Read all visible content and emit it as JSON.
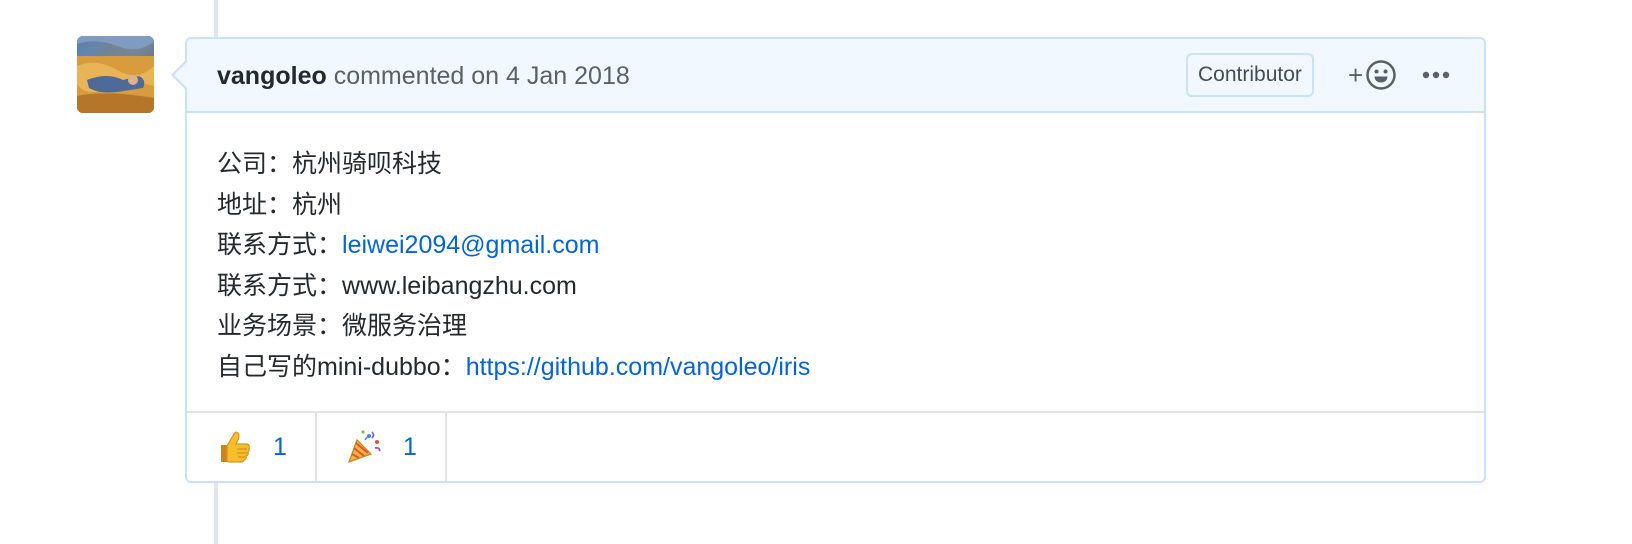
{
  "comment": {
    "author": "vangoleo",
    "action": "commented on",
    "date": "4 Jan 2018",
    "badge": "Contributor",
    "add_reaction_label": "+",
    "icons": {
      "avatar": "user-avatar",
      "add_reaction": "smiley-icon",
      "more": "kebab-horizontal-icon"
    },
    "body": [
      {
        "label": "公司：",
        "value": "杭州骑呗科技",
        "link": false
      },
      {
        "label": "地址：",
        "value": "杭州",
        "link": false
      },
      {
        "label": "联系方式：",
        "value": "leiwei2094@gmail.com",
        "link": true
      },
      {
        "label": "联系方式：",
        "value": "www.leibangzhu.com",
        "link": false
      },
      {
        "label": "业务场景：",
        "value": "微服务治理",
        "link": false
      },
      {
        "label": "自己写的mini-dubbo：",
        "value": "https://github.com/vangoleo/iris",
        "link": true
      }
    ],
    "reactions": [
      {
        "emoji": "thumbs-up-icon",
        "count": "1"
      },
      {
        "emoji": "party-popper-icon",
        "count": "1"
      }
    ]
  },
  "colors": {
    "header_bg": "#f1f8ff",
    "border": "#c8e1ff",
    "link": "#0366d6",
    "muted": "#586069"
  }
}
